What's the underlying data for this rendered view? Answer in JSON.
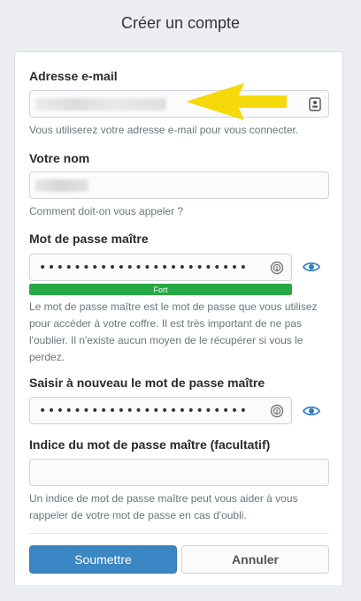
{
  "page": {
    "title": "Créer un compte"
  },
  "form": {
    "email": {
      "label": "Adresse e-mail",
      "hint": "Vous utiliserez votre adresse e-mail pour vous connecter."
    },
    "name": {
      "label": "Votre nom",
      "hint": "Comment doit-on vous appeler ?"
    },
    "master_password": {
      "label": "Mot de passe maître",
      "value_masked": "••••••••••••••••••••••••",
      "strength_label": "Fort",
      "strength_level": 1.0,
      "hint": "Le mot de passe maître est le mot de passe que vous utilisez pour accéder à votre coffre. Il est très important de ne pas l'oublier. Il n'existe aucun moyen de le récupérer si vous le perdez."
    },
    "confirm_password": {
      "label": "Saisir à nouveau le mot de passe maître",
      "value_masked": "••••••••••••••••••••••••"
    },
    "password_hint": {
      "label": "Indice du mot de passe maître (facultatif)",
      "value": "",
      "hint": "Un indice de mot de passe maître peut vous aider à vous rappeler de votre mot de passe en cas d'oubli."
    }
  },
  "buttons": {
    "submit": "Soumettre",
    "cancel": "Annuler"
  },
  "icons": {
    "field_icon": "contact-card-icon",
    "password_icon": "fingerprint-icon",
    "toggle_icon": "eye-icon",
    "annotation": "arrow-left-icon"
  },
  "colors": {
    "accent": "#3a87c3",
    "strength": "#28a745",
    "eye": "#2d7fc0",
    "annotation_arrow": "#f5d90a"
  }
}
